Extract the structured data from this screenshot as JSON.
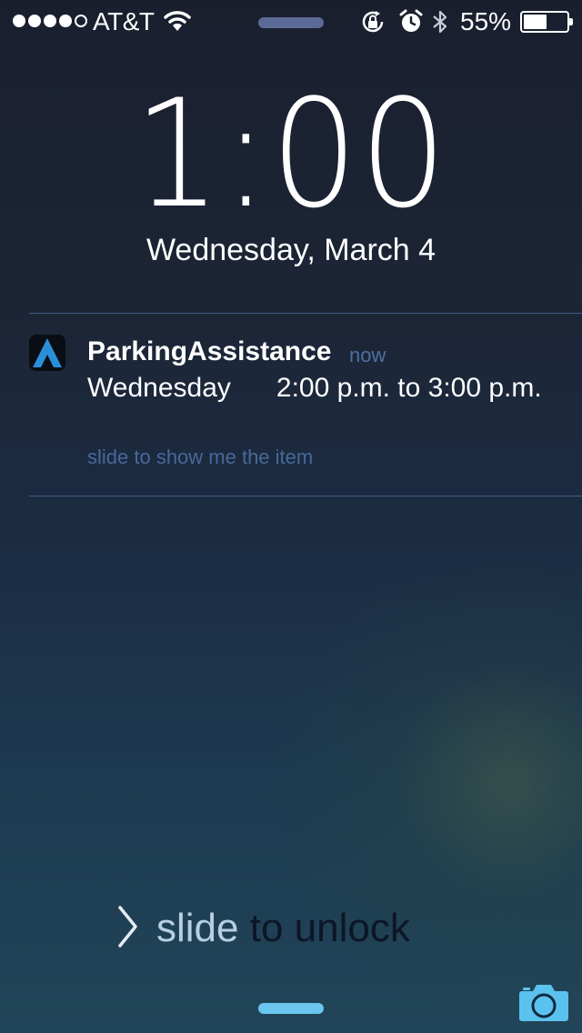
{
  "status_bar": {
    "signal_bars_filled": 4,
    "signal_bars_total": 5,
    "carrier": "AT&T",
    "battery_percent": "55%",
    "battery_level": 0.55,
    "icons": [
      "wifi-icon",
      "rotation-lock-icon",
      "alarm-icon",
      "bluetooth-icon",
      "battery-icon"
    ]
  },
  "lock_screen": {
    "time": "1:00",
    "date": "Wednesday, March 4"
  },
  "notification": {
    "app_name": "ParkingAssistance",
    "time_ago": "now",
    "message": "Wednesday      2:00 p.m. to 3:00 p.m.",
    "action_hint": "slide to show me the item",
    "app_icon": "parking-assistance-app-icon"
  },
  "unlock": {
    "label_shine": "slide",
    "label_rest": " to unlock",
    "chevron_icon": "chevron-right-icon"
  },
  "camera": {
    "icon": "camera-icon"
  },
  "colors": {
    "notification_secondary": "#4f6f9d",
    "grabber_bottom": "#6ac6ee",
    "camera": "#5bc2ee"
  }
}
